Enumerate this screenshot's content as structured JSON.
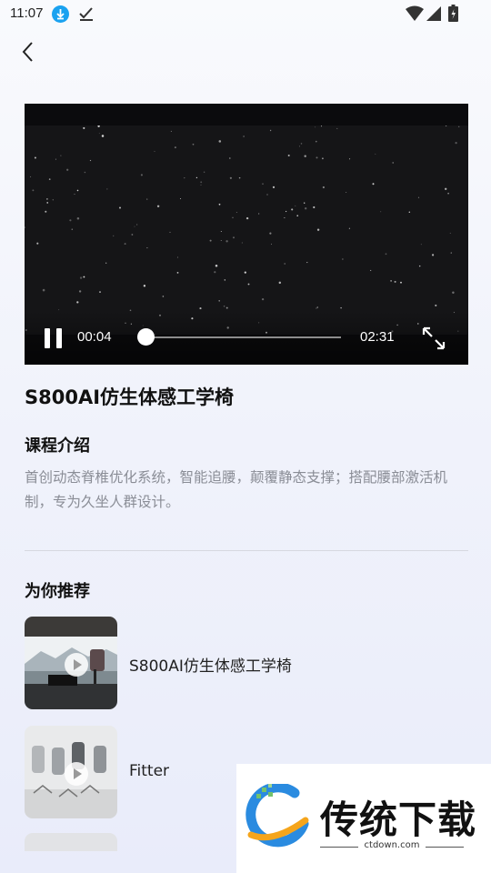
{
  "status_bar": {
    "time": "11:07",
    "icons": [
      "download-icon",
      "check-icon",
      "wifi-icon",
      "signal-icon",
      "battery-icon"
    ]
  },
  "nav": {
    "back_icon": "chevron-left-icon"
  },
  "video": {
    "current_time": "00:04",
    "total_time": "02:31",
    "progress": 0.026,
    "state": "playing",
    "controls": [
      "pause-icon",
      "fullscreen-icon"
    ]
  },
  "course": {
    "title": "S800AI仿生体感工学椅",
    "intro_heading": "课程介绍",
    "description": "首创动态脊椎优化系统，智能追腰，颠覆静态支撑；搭配腰部激活机制，专为久坐人群设计。"
  },
  "recommend": {
    "heading": "为你推荐",
    "items": [
      {
        "title": "S800AI仿生体感工学椅"
      },
      {
        "title": "Fitter"
      }
    ]
  },
  "watermark": {
    "title": "传统下载",
    "url": "ctdown.com"
  },
  "colors": {
    "accent": "#1aa2f0",
    "background": "#f1f3fb",
    "muted_text": "#8a8d96"
  }
}
